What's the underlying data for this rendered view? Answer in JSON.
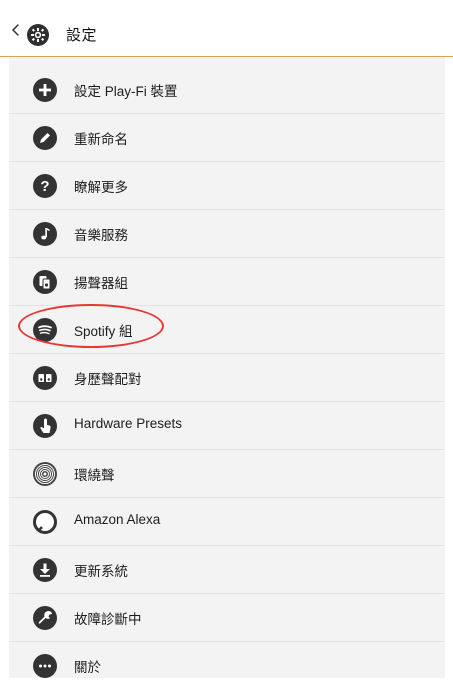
{
  "header": {
    "title": "設定"
  },
  "menu": {
    "items": [
      {
        "label": "設定 Play-Fi 裝置"
      },
      {
        "label": "重新命名"
      },
      {
        "label": "瞭解更多"
      },
      {
        "label": "音樂服務"
      },
      {
        "label": "揚聲器組"
      },
      {
        "label": "Spotify 組"
      },
      {
        "label": "身歷聲配對"
      },
      {
        "label": "Hardware Presets"
      },
      {
        "label": "環繞聲"
      },
      {
        "label": "Amazon Alexa"
      },
      {
        "label": "更新系統"
      },
      {
        "label": "故障診斷中"
      },
      {
        "label": "關於"
      }
    ]
  },
  "colors": {
    "accent_line": "#d9a45a",
    "highlight": "#e53935",
    "icon_dark": "#3b3b3b"
  }
}
